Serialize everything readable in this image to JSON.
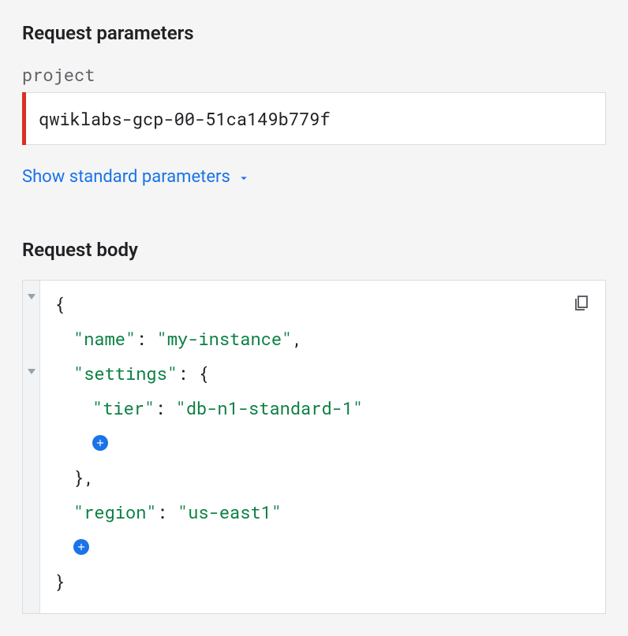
{
  "sections": {
    "params_title": "Request parameters",
    "body_title": "Request body"
  },
  "params": {
    "project": {
      "label": "project",
      "value": "qwiklabs-gcp-00-51ca149b779f"
    }
  },
  "show_standard_params": "Show standard parameters",
  "body": {
    "name_key": "\"name\"",
    "name_value": "\"my-instance\"",
    "settings_key": "\"settings\"",
    "tier_key": "\"tier\"",
    "tier_value": "\"db-n1-standard-1\"",
    "region_key": "\"region\"",
    "region_value": "\"us-east1\""
  },
  "icons": {
    "chevron_down": "chevron-down-icon",
    "copy": "copy-icon",
    "add": "add-icon"
  }
}
